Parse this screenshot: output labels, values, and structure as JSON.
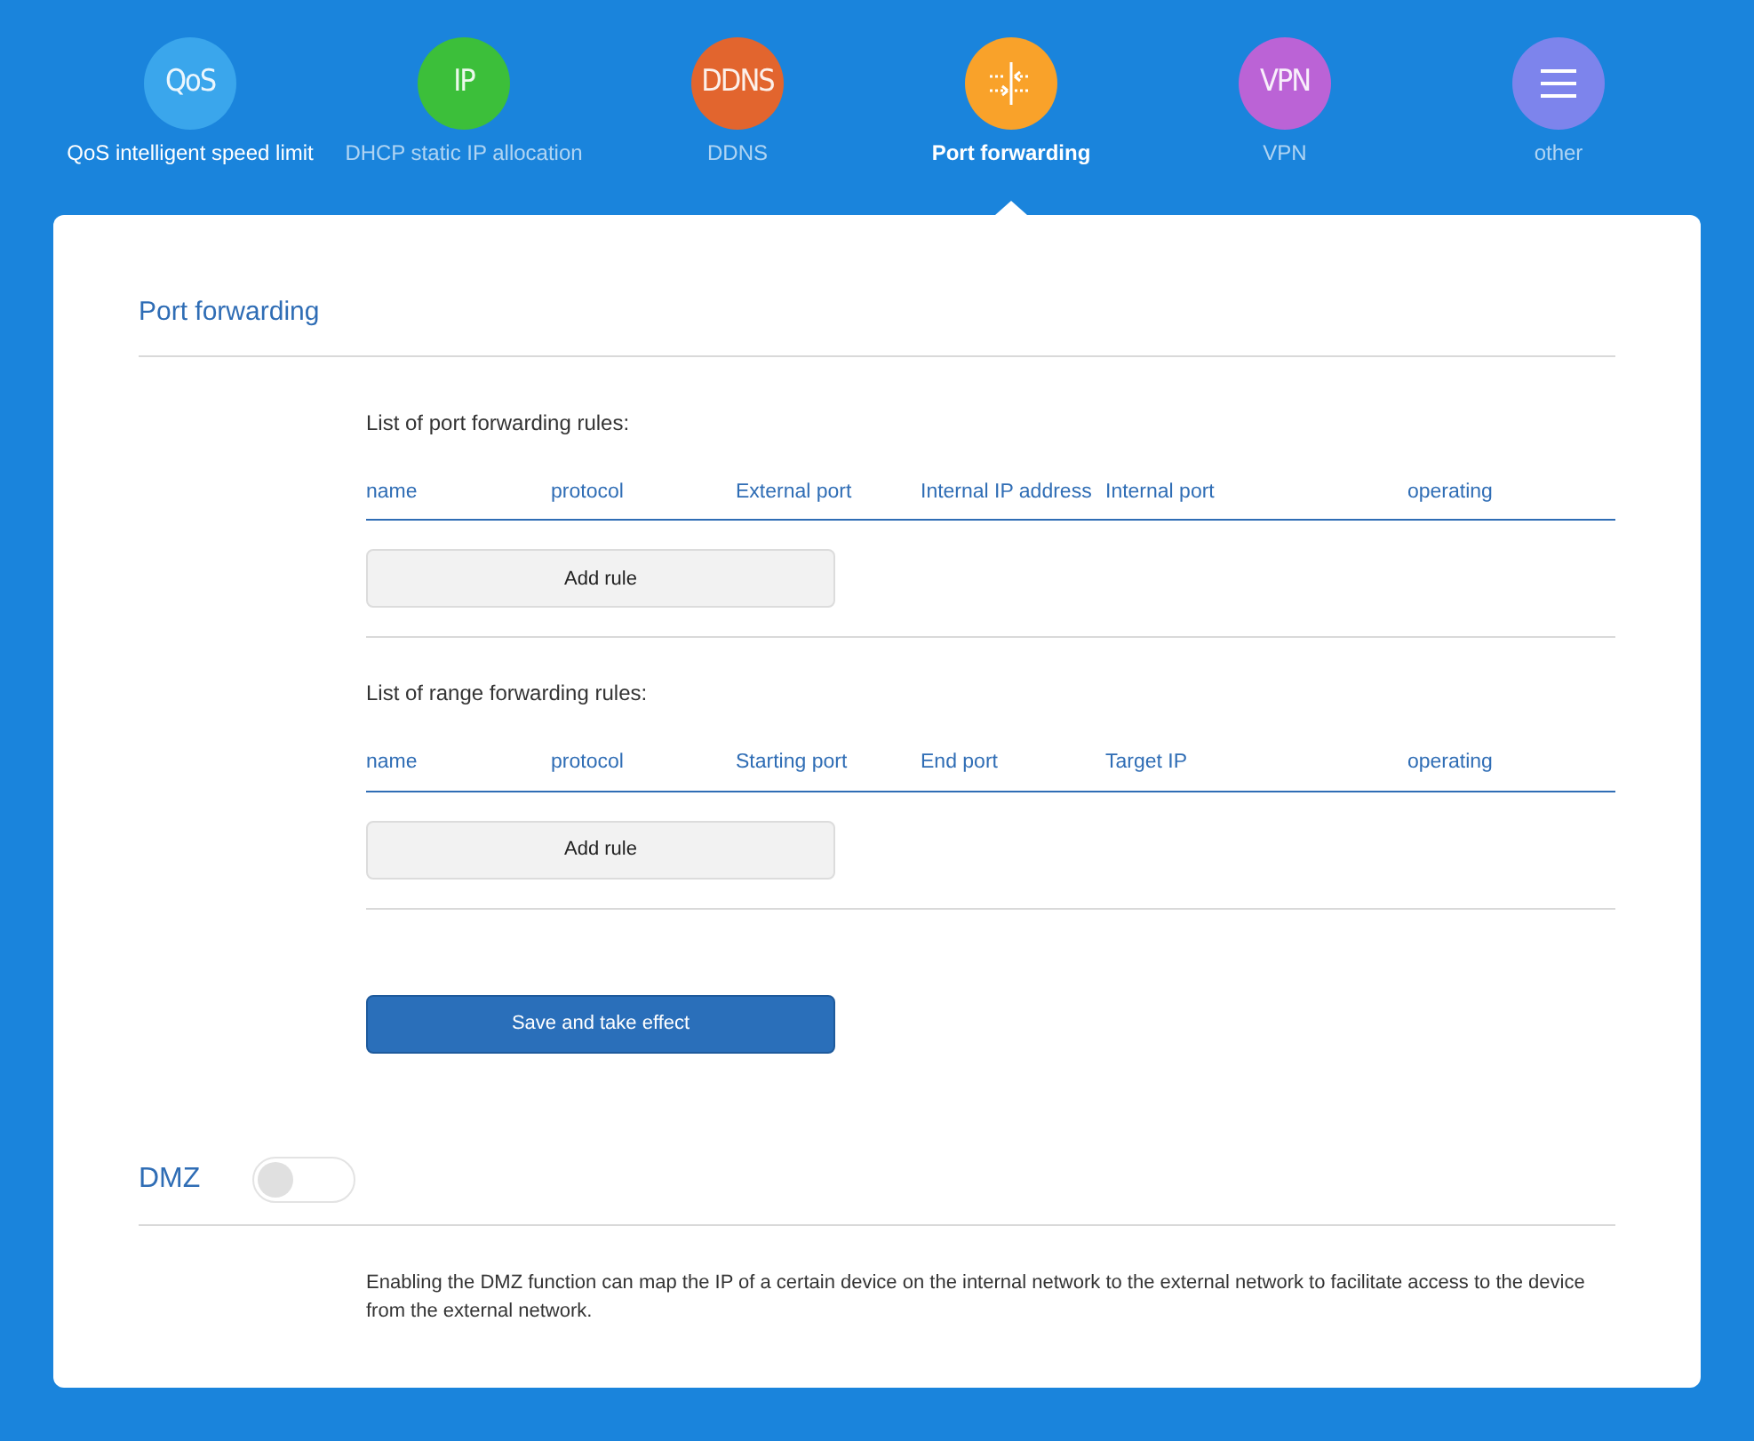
{
  "nav": [
    {
      "kind": "text",
      "glyph": "QoS",
      "color": "#3aa6ec",
      "label": "QoS intelligent speed limit",
      "selected": false,
      "highlighted": true
    },
    {
      "kind": "text",
      "glyph": "IP",
      "color": "#3cbf3a",
      "label": "DHCP static IP allocation",
      "selected": false
    },
    {
      "kind": "text",
      "glyph": "DDNS",
      "color": "#e2652e",
      "label": "DDNS",
      "selected": false
    },
    {
      "kind": "ports",
      "color": "#f9a22a",
      "label": "Port forwarding",
      "selected": true
    },
    {
      "kind": "text",
      "glyph": "VPN",
      "color": "#bb63d6",
      "label": "VPN",
      "selected": false
    },
    {
      "kind": "menu",
      "color": "#7d84ec",
      "label": "other",
      "selected": false
    }
  ],
  "section_title": "Port forwarding",
  "port_rules": {
    "caption": "List of port forwarding rules:",
    "columns": [
      "name",
      "protocol",
      "External port",
      "Internal IP address",
      "Internal port",
      "operating"
    ],
    "add_button": "Add rule"
  },
  "range_rules": {
    "caption": "List of range forwarding rules:",
    "columns": [
      "name",
      "protocol",
      "Starting port",
      "End port",
      "Target IP",
      "operating"
    ],
    "add_button": "Add rule"
  },
  "save_button": "Save and take effect",
  "dmz": {
    "label": "DMZ",
    "on": false,
    "description": "Enabling the DMZ function can map the IP of a certain device on the internal network to the external network to facilitate access to the device from the external network."
  }
}
